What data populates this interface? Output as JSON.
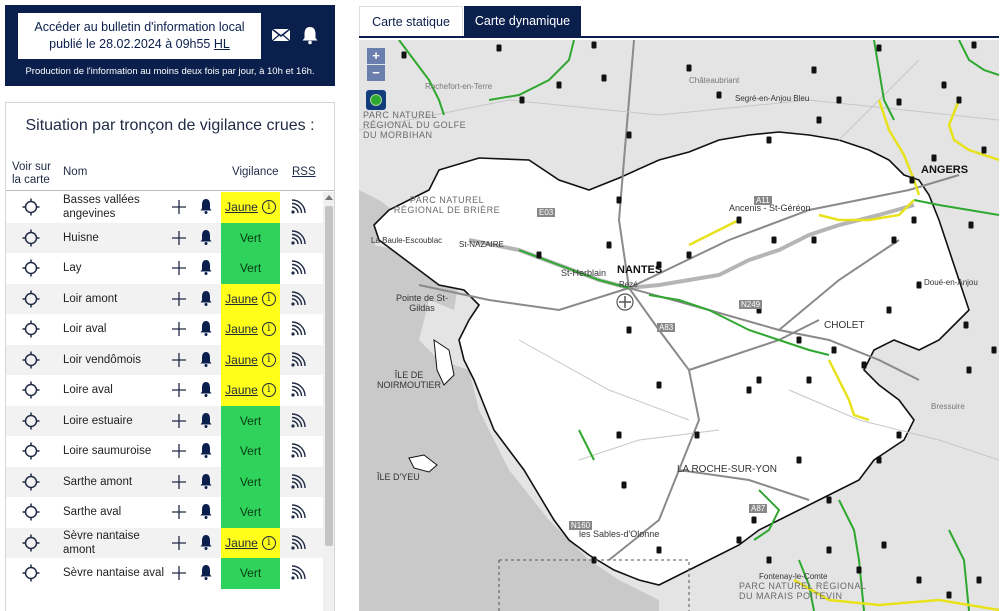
{
  "bulletin": {
    "line1": "Accéder au bulletin d'information local",
    "line2_prefix": "publié le 28.02.2024 à 09h55",
    "line2_hl": "HL",
    "note": "Production de l'information au moins deux fois par jour, à 10h et 16h.",
    "icons": [
      "envelope-icon",
      "bell-icon"
    ]
  },
  "panel": {
    "title": "Situation par tronçon de vigilance crues :",
    "headers": {
      "voir": "Voir sur la carte",
      "nom": "Nom",
      "vigilance": "Vigilance",
      "rss": "RSS"
    },
    "rows": [
      {
        "name": "Basses vallées angevines",
        "level": "Jaune",
        "type": "jaune"
      },
      {
        "name": "Huisne",
        "level": "Vert",
        "type": "vert"
      },
      {
        "name": "Lay",
        "level": "Vert",
        "type": "vert"
      },
      {
        "name": "Loir amont",
        "level": "Jaune",
        "type": "jaune"
      },
      {
        "name": "Loir aval",
        "level": "Jaune",
        "type": "jaune"
      },
      {
        "name": "Loir vendômois",
        "level": "Jaune",
        "type": "jaune"
      },
      {
        "name": "Loire aval",
        "level": "Jaune",
        "type": "jaune"
      },
      {
        "name": "Loire estuaire",
        "level": "Vert",
        "type": "vert"
      },
      {
        "name": "Loire saumuroise",
        "level": "Vert",
        "type": "vert"
      },
      {
        "name": "Sarthe amont",
        "level": "Vert",
        "type": "vert"
      },
      {
        "name": "Sarthe aval",
        "level": "Vert",
        "type": "vert"
      },
      {
        "name": "Sèvre nantaise amont",
        "level": "Jaune",
        "type": "jaune"
      },
      {
        "name": "Sèvre nantaise aval",
        "level": "Vert",
        "type": "vert"
      }
    ],
    "info_glyph": "i"
  },
  "tabs": {
    "static": "Carte statique",
    "dynamic": "Carte dynamique"
  },
  "map": {
    "zoom_in": "+",
    "zoom_out": "−",
    "labels": {
      "angers": "ANGERS",
      "nantes": "NANTES",
      "cholet": "CHOLET",
      "larochesuryon": "LA ROCHE-SUR-YON",
      "stherblain": "St-Herblain",
      "rezé": "Rezé",
      "ancenis": "Ancenis - St-Géréon",
      "stnazaire": "St-NAZAIRE",
      "labaule": "La Baule-Escoublac",
      "pointe": "Pointe de St-Gildas",
      "noirmoutier": "ÎLE DE NOIRMOUTIER",
      "yeu": "ÎLE D'YEU",
      "sables": "les Sables-d'Olonne",
      "segre": "Segré-en-Anjou Bleu",
      "chateaubriant": "Châteaubriant",
      "rochefort": "Rochefort-en-Terre",
      "doue": "Doué-en-Anjou",
      "fontenay": "Fontenay-le-Comte",
      "bressuire": "Bressuire",
      "parc_briere": "PARC NATUREL RÉGIONAL DE BRIÈRE",
      "parc_morbihan": "PARC NATUREL RÉGIONAL DU GOLFE DU MORBIHAN",
      "parc_poitevin": "PARC NATUREL RÉGIONAL DU MARAIS POITEVIN",
      "a11": "A11",
      "a83": "A83",
      "a87": "A87",
      "n249": "N249",
      "n160": "N160",
      "e03": "E03"
    },
    "colors": {
      "vert": "#2fa82f",
      "jaune": "#e8e21a",
      "land": "#ffffff",
      "outside": "#e4e4e4",
      "sea": "#c9c9c9"
    }
  }
}
